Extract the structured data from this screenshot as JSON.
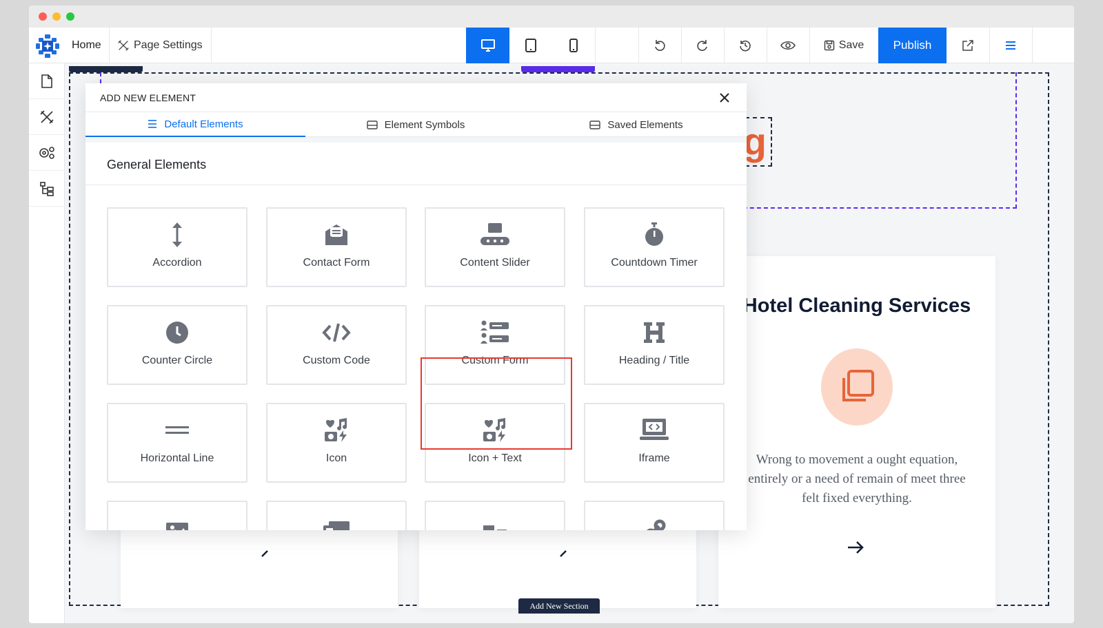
{
  "toolbar": {
    "home": "Home",
    "page_settings": "Page Settings",
    "save": "Save",
    "publish": "Publish",
    "accent_color": "#0b6ff0"
  },
  "modal": {
    "title": "ADD NEW ELEMENT",
    "tabs": [
      {
        "label": "Default Elements",
        "icon": "list-icon",
        "active": true
      },
      {
        "label": "Element Symbols",
        "icon": "symbol-icon",
        "active": false
      },
      {
        "label": "Saved Elements",
        "icon": "saved-icon",
        "active": false
      }
    ],
    "section_title": "General Elements",
    "elements": [
      {
        "label": "Accordion",
        "icon": "accordion-icon"
      },
      {
        "label": "Contact Form",
        "icon": "envelope-icon"
      },
      {
        "label": "Content Slider",
        "icon": "slider-icon"
      },
      {
        "label": "Countdown Timer",
        "icon": "stopwatch-icon"
      },
      {
        "label": "Counter Circle",
        "icon": "clock-icon"
      },
      {
        "label": "Custom Code",
        "icon": "code-icon"
      },
      {
        "label": "Custom Form",
        "icon": "form-list-icon"
      },
      {
        "label": "Heading / Title",
        "icon": "heading-icon"
      },
      {
        "label": "Horizontal Line",
        "icon": "hr-icon"
      },
      {
        "label": "Icon",
        "icon": "media-icons-icon"
      },
      {
        "label": "Icon + Text",
        "icon": "media-icons-icon"
      },
      {
        "label": "Iframe",
        "icon": "iframe-icon"
      },
      {
        "label": "",
        "icon": "image-icon"
      },
      {
        "label": "",
        "icon": "gallery-icon"
      },
      {
        "label": "",
        "icon": "blocks-icon"
      },
      {
        "label": "",
        "icon": "link-icon"
      }
    ],
    "highlighted": "Custom Form"
  },
  "page": {
    "card_title": "Hotel Cleaning Services",
    "card_text": "Wrong to movement a ought equation, entirely or a need of remain of meet three felt fixed everything.",
    "heading_fragment": "g",
    "add_section": "Add New Section",
    "accent_orange": "#e8643a"
  }
}
